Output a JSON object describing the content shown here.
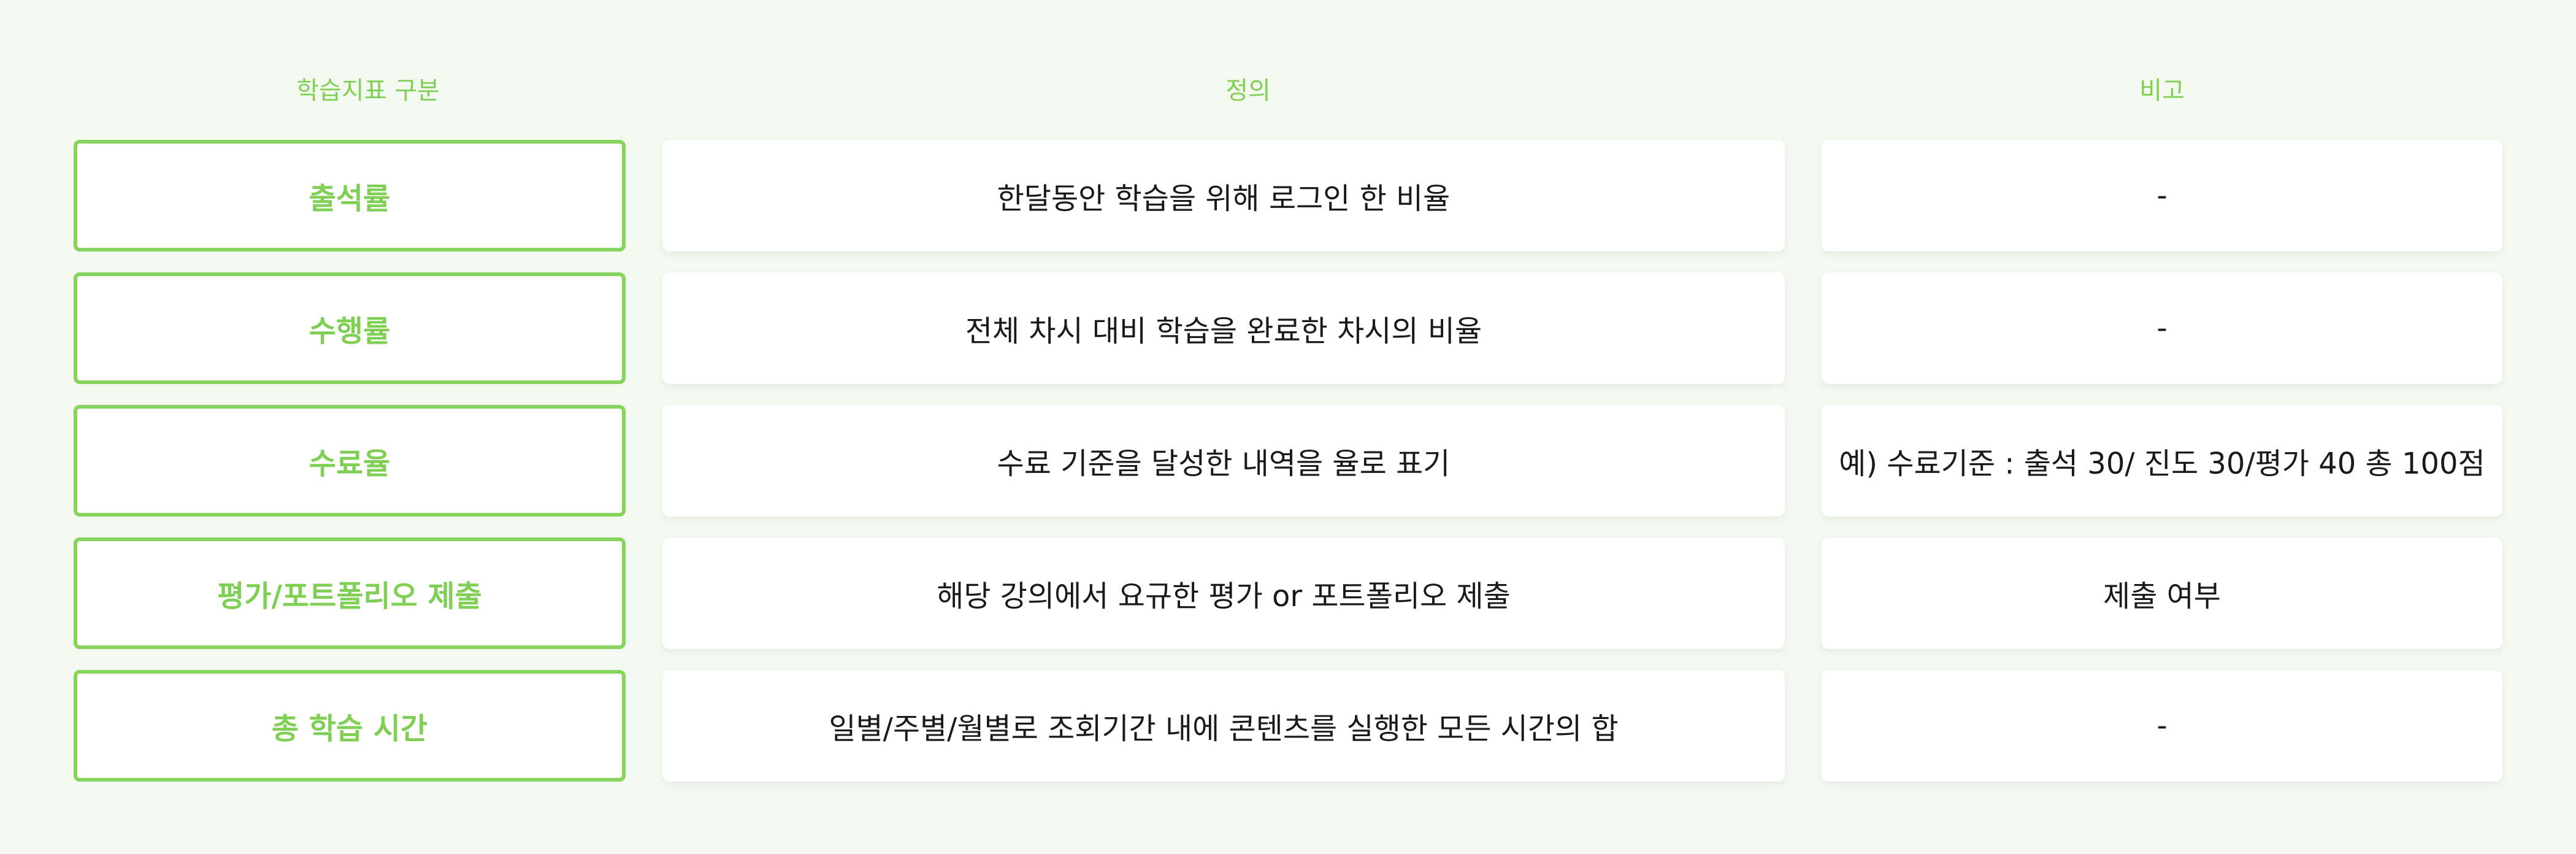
{
  "colors": {
    "background": "#f4f9f0",
    "accent": "#7fcf55",
    "border": "#86d35d",
    "cell_background": "#ffffff",
    "text": "#1a1a1a"
  },
  "headers": {
    "metric": "학습지표 구분",
    "definition": "정의",
    "note": "비고"
  },
  "rows": [
    {
      "metric": "출석률",
      "definition": "한달동안 학습을 위해 로그인 한 비율",
      "note": "-"
    },
    {
      "metric": "수행률",
      "definition": "전체 차시 대비 학습을 완료한 차시의 비율",
      "note": "-"
    },
    {
      "metric": "수료율",
      "definition": "수료 기준을 달성한 내역을 율로 표기",
      "note": "예) 수료기준 : 출석 30/ 진도 30/평가 40 총 100점"
    },
    {
      "metric": "평가/포트폴리오 제출",
      "definition": "해당 강의에서 요규한 평가 or 포트폴리오 제출",
      "note": "제출 여부"
    },
    {
      "metric": "총 학습 시간",
      "definition": "일별/주별/월별로 조회기간 내에 콘텐츠를 실행한 모든 시간의 합",
      "note": "-"
    }
  ]
}
